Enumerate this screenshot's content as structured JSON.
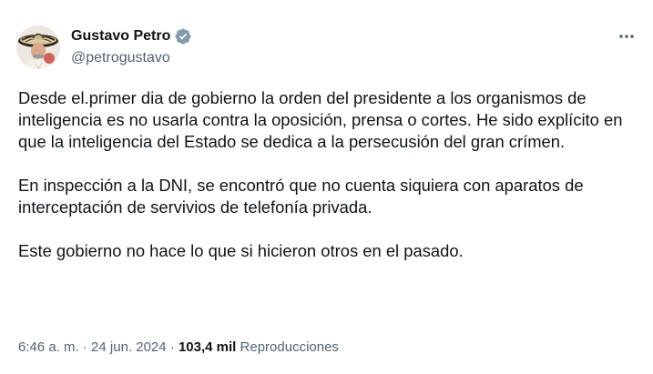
{
  "author": {
    "display_name": "Gustavo Petro",
    "handle": "@petrogustavo",
    "verified_color": "#829aab"
  },
  "tweet": {
    "paragraphs": [
      "Desde el.primer dia de gobierno la orden del presidente a los organismos de inteligencia es no usarla contra la oposición, prensa o cortes. He sido explícito en que la inteligencia del Estado se dedica a la persecusión del gran crímen.",
      "En inspección a la DNI, se encontró que no cuenta siquiera con aparatos de interceptación de servivios de telefonía privada.",
      "Este gobierno no hace lo que si hicieron otros en el pasado."
    ]
  },
  "meta": {
    "time": "6:46 a. m.",
    "separator": "·",
    "date": "24 jun. 2024",
    "views_count": "103,4 mil",
    "views_label": "Reproducciones"
  },
  "icons": {
    "more": "more-horizontal-icon",
    "verified": "verified-badge-icon"
  },
  "colors": {
    "text_primary": "#0f1419",
    "text_secondary": "#536471",
    "background": "#ffffff"
  }
}
